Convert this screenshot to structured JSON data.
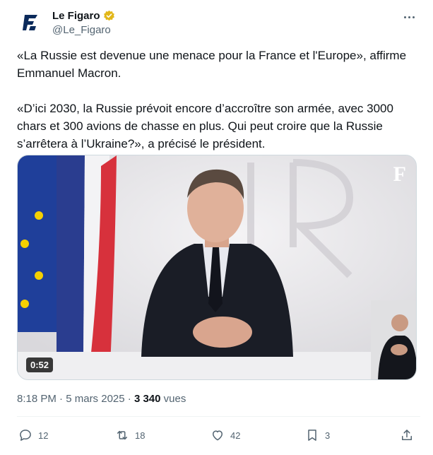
{
  "author": {
    "name": "Le Figaro",
    "handle": "@Le_Figaro",
    "verified": true,
    "avatar_icon": "figaro-logo-icon",
    "avatar_letter": "F"
  },
  "tweet": {
    "paragraph_1": "«La Russie est devenue une menace pour la France et l'Europe», affirme Emmanuel Macron.",
    "paragraph_2": "«D’ici 2030, la Russie prévoit encore d’accroître son armée, avec 3000 chars et 300 avions de chasse en plus. Qui peut croire que la Russie s’arrêtera à l’Ukraine?», a précisé le président."
  },
  "video": {
    "duration": "0:52",
    "watermark": "F"
  },
  "meta": {
    "time": "8:18 PM",
    "separator_1": "·",
    "date": "5 mars 2025",
    "separator_2": "·",
    "views_count": "3 340",
    "views_label": "vues"
  },
  "actions": {
    "replies": "12",
    "reposts": "18",
    "likes": "42",
    "bookmarks": "3"
  },
  "colors": {
    "text": "#0f1419",
    "secondary": "#536471",
    "verified_gold": "#e2b719",
    "divider": "#eff3f4"
  }
}
